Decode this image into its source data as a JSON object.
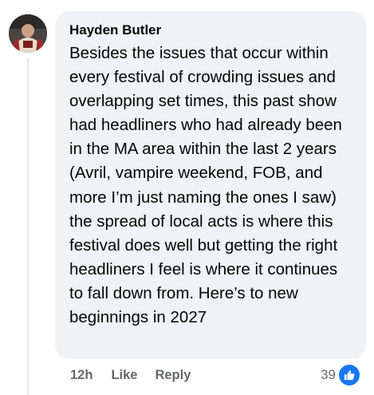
{
  "comment": {
    "author": "Hayden Butler",
    "text": "Besides the issues that occur within every festival of crowding issues and overlapping set times, this past show had headliners who had already been in the MA area within the last 2 years (Avril, vampire weekend, FOB, and more I’m just naming the ones I saw) the spread of local acts is where this festival does well but getting the right headliners I feel is where it continues to fall down from. Here’s to new beginnings in 2027",
    "timestamp": "12h",
    "like_label": "Like",
    "reply_label": "Reply",
    "reaction_count": "39",
    "reaction_icon": "thumbs-up-icon",
    "colors": {
      "bubble": "#f0f2f5",
      "reaction": "#1877f2",
      "meta_text": "#65676b"
    }
  }
}
